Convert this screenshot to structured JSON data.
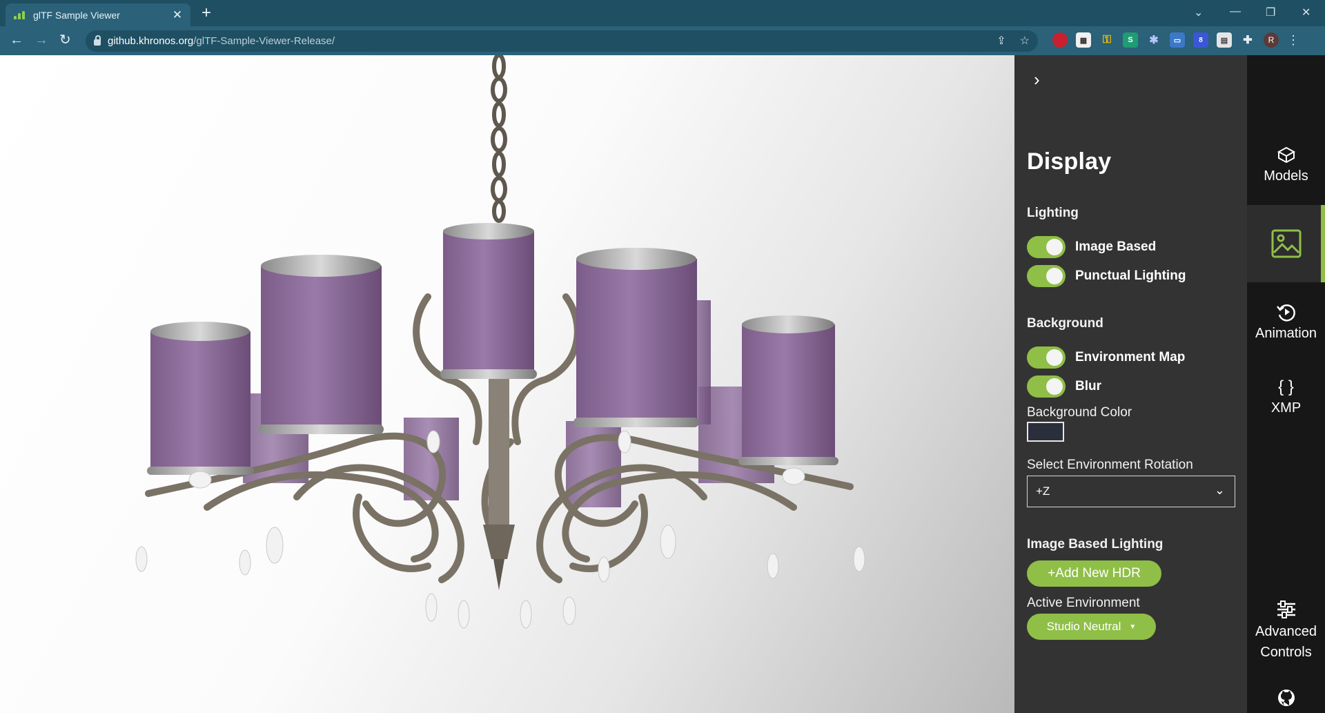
{
  "browser": {
    "tab_title": "glTF Sample Viewer",
    "tab_close": "✕",
    "new_tab": "+",
    "url_host": "github.khronos.org",
    "url_path": "/glTF-Sample-Viewer-Release/",
    "avatar_initial": "R",
    "extension_badge": "8"
  },
  "panel": {
    "collapse_icon": "chevron-right-icon",
    "title": "Display",
    "lighting": {
      "heading": "Lighting",
      "image_based": "Image Based",
      "punctual": "Punctual Lighting"
    },
    "background": {
      "heading": "Background",
      "environment_map": "Environment Map",
      "blur": "Blur",
      "color_label": "Background Color",
      "color_value": "#2b2f3b"
    },
    "rotation": {
      "label": "Select Environment Rotation",
      "value": "+Z"
    },
    "ibl": {
      "heading": "Image Based Lighting",
      "add_hdr": "+Add New HDR",
      "active_label": "Active Environment",
      "active_value": "Studio Neutral"
    }
  },
  "rail": {
    "models": "Models",
    "display_icon": "image-icon",
    "animation": "Animation",
    "xmp_icon": "{ }",
    "xmp": "XMP",
    "advanced_1": "Advanced",
    "advanced_2": "Controls"
  },
  "colors": {
    "accent": "#8fbf47",
    "panel_bg": "#333333",
    "rail_bg": "#171717",
    "chrome": "#2b6179"
  }
}
